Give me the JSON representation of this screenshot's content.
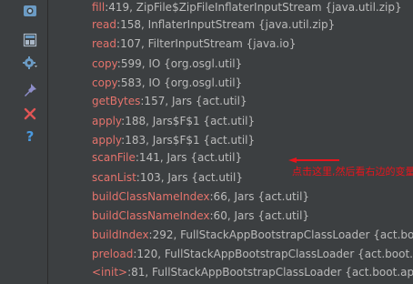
{
  "toolbar": {
    "icons": [
      "camera-icon",
      "layout-icon",
      "settings-icon",
      "pin-icon",
      "close-icon",
      "help-icon"
    ]
  },
  "frames": [
    {
      "method": "fill",
      "rest": ":419, ZipFile$ZipFileInflaterInputStream {java.util.zip}"
    },
    {
      "method": "read",
      "rest": ":158, InflaterInputStream {java.util.zip}"
    },
    {
      "method": "read",
      "rest": ":107, FilterInputStream {java.io}"
    },
    {
      "method": "copy",
      "rest": ":599, IO {org.osgl.util}"
    },
    {
      "method": "copy",
      "rest": ":583, IO {org.osgl.util}"
    },
    {
      "method": "getBytes",
      "rest": ":157, Jars {act.util}"
    },
    {
      "method": "apply",
      "rest": ":188, Jars$F$1 {act.util}"
    },
    {
      "method": "apply",
      "rest": ":183, Jars$F$1 {act.util}"
    },
    {
      "method": "scanFile",
      "rest": ":141, Jars {act.util}"
    },
    {
      "method": "scanList",
      "rest": ":103, Jars {act.util}"
    },
    {
      "method": "buildClassNameIndex",
      "rest": ":66, Jars {act.util}"
    },
    {
      "method": "buildClassNameIndex",
      "rest": ":60, Jars {act.util}"
    },
    {
      "method": "buildIndex",
      "rest": ":292, FullStackAppBootstrapClassLoader {act.boot"
    },
    {
      "method": "preload",
      "rest": ":120, FullStackAppBootstrapClassLoader {act.boot.ap"
    },
    {
      "method": "<init>",
      "rest": ":81, FullStackAppBootstrapClassLoader {act.boot.app}"
    }
  ],
  "annotation": {
    "text": "点击这里,然后看右边的变量列表",
    "color": "#e8141c"
  },
  "colors": {
    "method": "#e5736c",
    "rest": "#bbbbbb",
    "background": "#3c3f41"
  }
}
